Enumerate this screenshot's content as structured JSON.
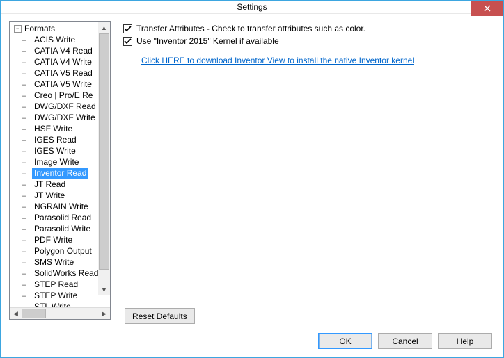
{
  "window": {
    "title": "Settings"
  },
  "tree": {
    "root_label": "Formats",
    "items": [
      {
        "label": "ACIS Write",
        "selected": false
      },
      {
        "label": "CATIA V4 Read",
        "selected": false
      },
      {
        "label": "CATIA V4 Write",
        "selected": false
      },
      {
        "label": "CATIA V5 Read",
        "selected": false
      },
      {
        "label": "CATIA V5 Write",
        "selected": false
      },
      {
        "label": "Creo | Pro/E Re",
        "selected": false
      },
      {
        "label": "DWG/DXF Read",
        "selected": false
      },
      {
        "label": "DWG/DXF Write",
        "selected": false
      },
      {
        "label": "HSF Write",
        "selected": false
      },
      {
        "label": "IGES Read",
        "selected": false
      },
      {
        "label": "IGES Write",
        "selected": false
      },
      {
        "label": "Image Write",
        "selected": false
      },
      {
        "label": "Inventor Read",
        "selected": true
      },
      {
        "label": "JT Read",
        "selected": false
      },
      {
        "label": "JT Write",
        "selected": false
      },
      {
        "label": "NGRAIN Write",
        "selected": false
      },
      {
        "label": "Parasolid Read",
        "selected": false
      },
      {
        "label": "Parasolid Write",
        "selected": false
      },
      {
        "label": "PDF Write",
        "selected": false
      },
      {
        "label": "Polygon Output",
        "selected": false
      },
      {
        "label": "SMS Write",
        "selected": false
      },
      {
        "label": "SolidWorks Read",
        "selected": false
      },
      {
        "label": "STEP Read",
        "selected": false
      },
      {
        "label": "STEP Write",
        "selected": false
      },
      {
        "label": "STL Write",
        "selected": false
      }
    ]
  },
  "options": {
    "transfer_attrs": {
      "checked": true,
      "label": "Transfer Attributes - Check to transfer attributes such as color."
    },
    "use_kernel": {
      "checked": true,
      "label": "Use \"Inventor 2015\" Kernel if available"
    },
    "link_text": "Click HERE to download Inventor View to install the native Inventor kernel"
  },
  "buttons": {
    "reset": "Reset Defaults",
    "ok": "OK",
    "cancel": "Cancel",
    "help": "Help"
  }
}
